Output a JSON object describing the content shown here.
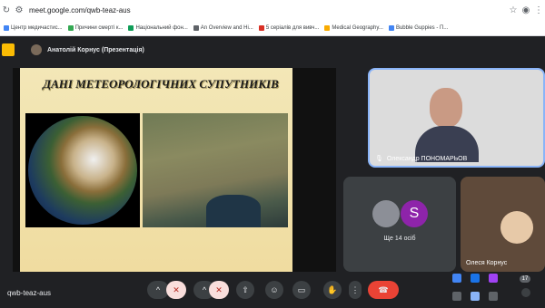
{
  "browser": {
    "url": "meet.google.com/qwb-teaz-aus",
    "bookmarks": [
      "Центр медичастис...",
      "Причини смерті к...",
      "Національний фон...",
      "An Overview and Hi...",
      "5 серіалів для вивч...",
      "Medical Geography...",
      "Bubble Guppies - П..."
    ]
  },
  "meeting": {
    "presenter_label": "Анатолій Корнус (Презентація)",
    "slide_title": "ДАНІ МЕТЕОРОЛОГІЧНИХ СУПУТНИКІВ",
    "tile1_name": "Олександр ПОНОМАРЬОВ",
    "more_label": "Ще 14 осіб",
    "avatar_letter": "S",
    "tile3_name": "Олеся Корнус",
    "meet_code": "qwb-teaz-aus",
    "participants_count": "17"
  },
  "colors": {
    "accent": "#8ab4f8",
    "end_call": "#ea4335",
    "slide_bg": "#f0dca0"
  }
}
